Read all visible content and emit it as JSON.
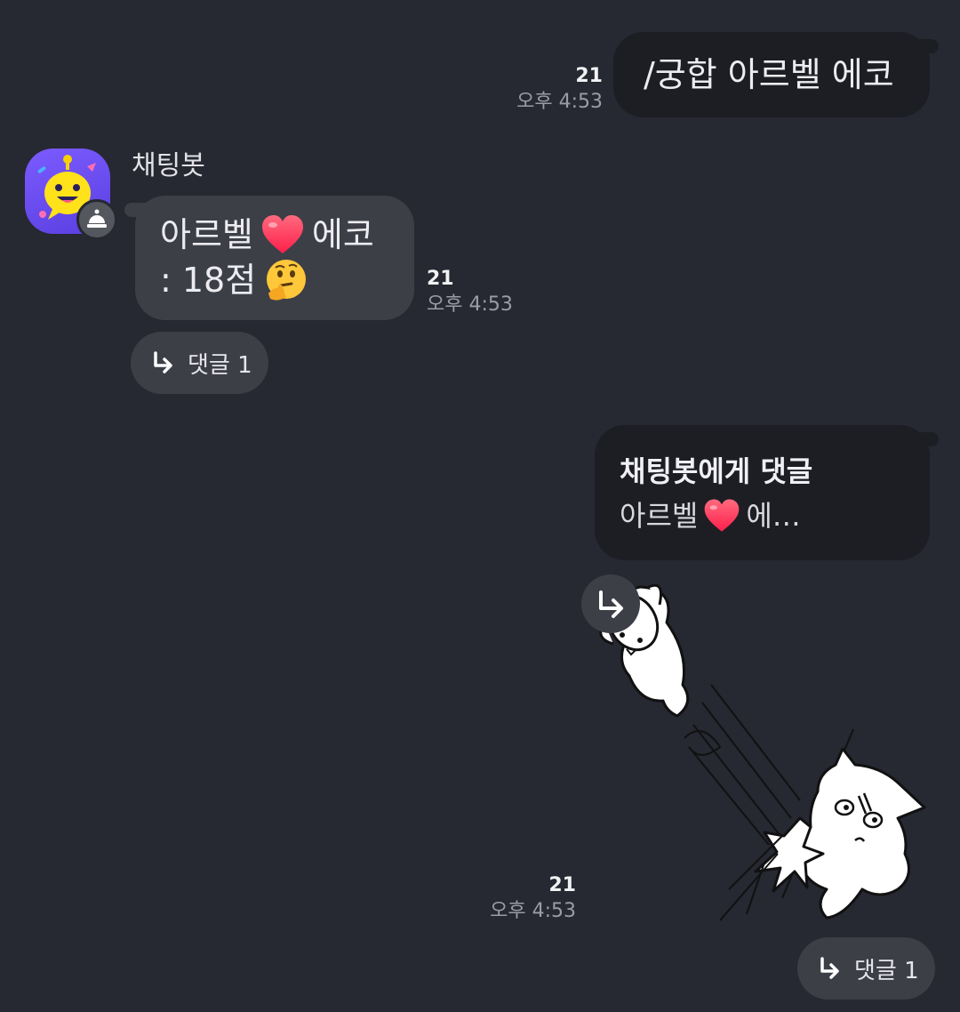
{
  "chat": {
    "msg1": {
      "text": "/궁합 아르벨 에코",
      "unread": "21",
      "time": "오후 4:53"
    },
    "bot": {
      "name": "채팅봇",
      "avatar_icon": "smiley-bot-icon",
      "badge_icon": "bell-bot-icon",
      "line1_a": "아르벨",
      "line1_emoji": "heart-emoji",
      "line1_b": "에코",
      "line2": ": 18점",
      "line2_emoji": "thinking-face-emoji",
      "unread": "21",
      "time": "오후 4:53",
      "reply_label": "댓글 1"
    },
    "reply_msg": {
      "header": "채팅봇에게 댓글",
      "preview_a": "아르벨",
      "preview_emoji": "heart-emoji",
      "preview_b": "에…",
      "sticker": "cat-kicking-dog-sticker",
      "unread": "21",
      "time": "오후 4:53",
      "reply_label": "댓글 1"
    }
  },
  "colors": {
    "background": "#262832",
    "sent_bubble": "#1d1e24",
    "recv_bubble": "#3d3f47",
    "avatar": "#6a4cf2",
    "heart": "#ff2d55"
  }
}
